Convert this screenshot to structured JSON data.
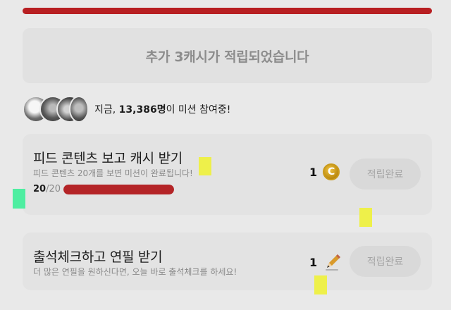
{
  "banner": {
    "text": "추가 3캐시가 적립되었습니다"
  },
  "participants": {
    "prefix": "지금, ",
    "count": "13,386명",
    "suffix": "이 미션 참여중!"
  },
  "missions": [
    {
      "title": "피드 콘텐츠 보고 캐시 받기",
      "subtitle": "피드 콘텐츠 20개를 보면 미션이 완료됩니다!",
      "progress_done": "20",
      "progress_total": "/20",
      "progress_fraction": 1.0,
      "reward_amount": "1",
      "reward_icon": "coin-icon",
      "button_label": "적립완료"
    },
    {
      "title": "출석체크하고 연필 받기",
      "subtitle": "더 많은 연필을 원하신다면, 오늘 바로 출석체크를 하세요!",
      "reward_amount": "1",
      "reward_icon": "pencil-icon",
      "button_label": "적립완료"
    }
  ],
  "colors": {
    "accent": "#b81f22",
    "background": "#e9e9e9",
    "marker_yellow": "#eef04a",
    "marker_green": "#4eeea1"
  }
}
